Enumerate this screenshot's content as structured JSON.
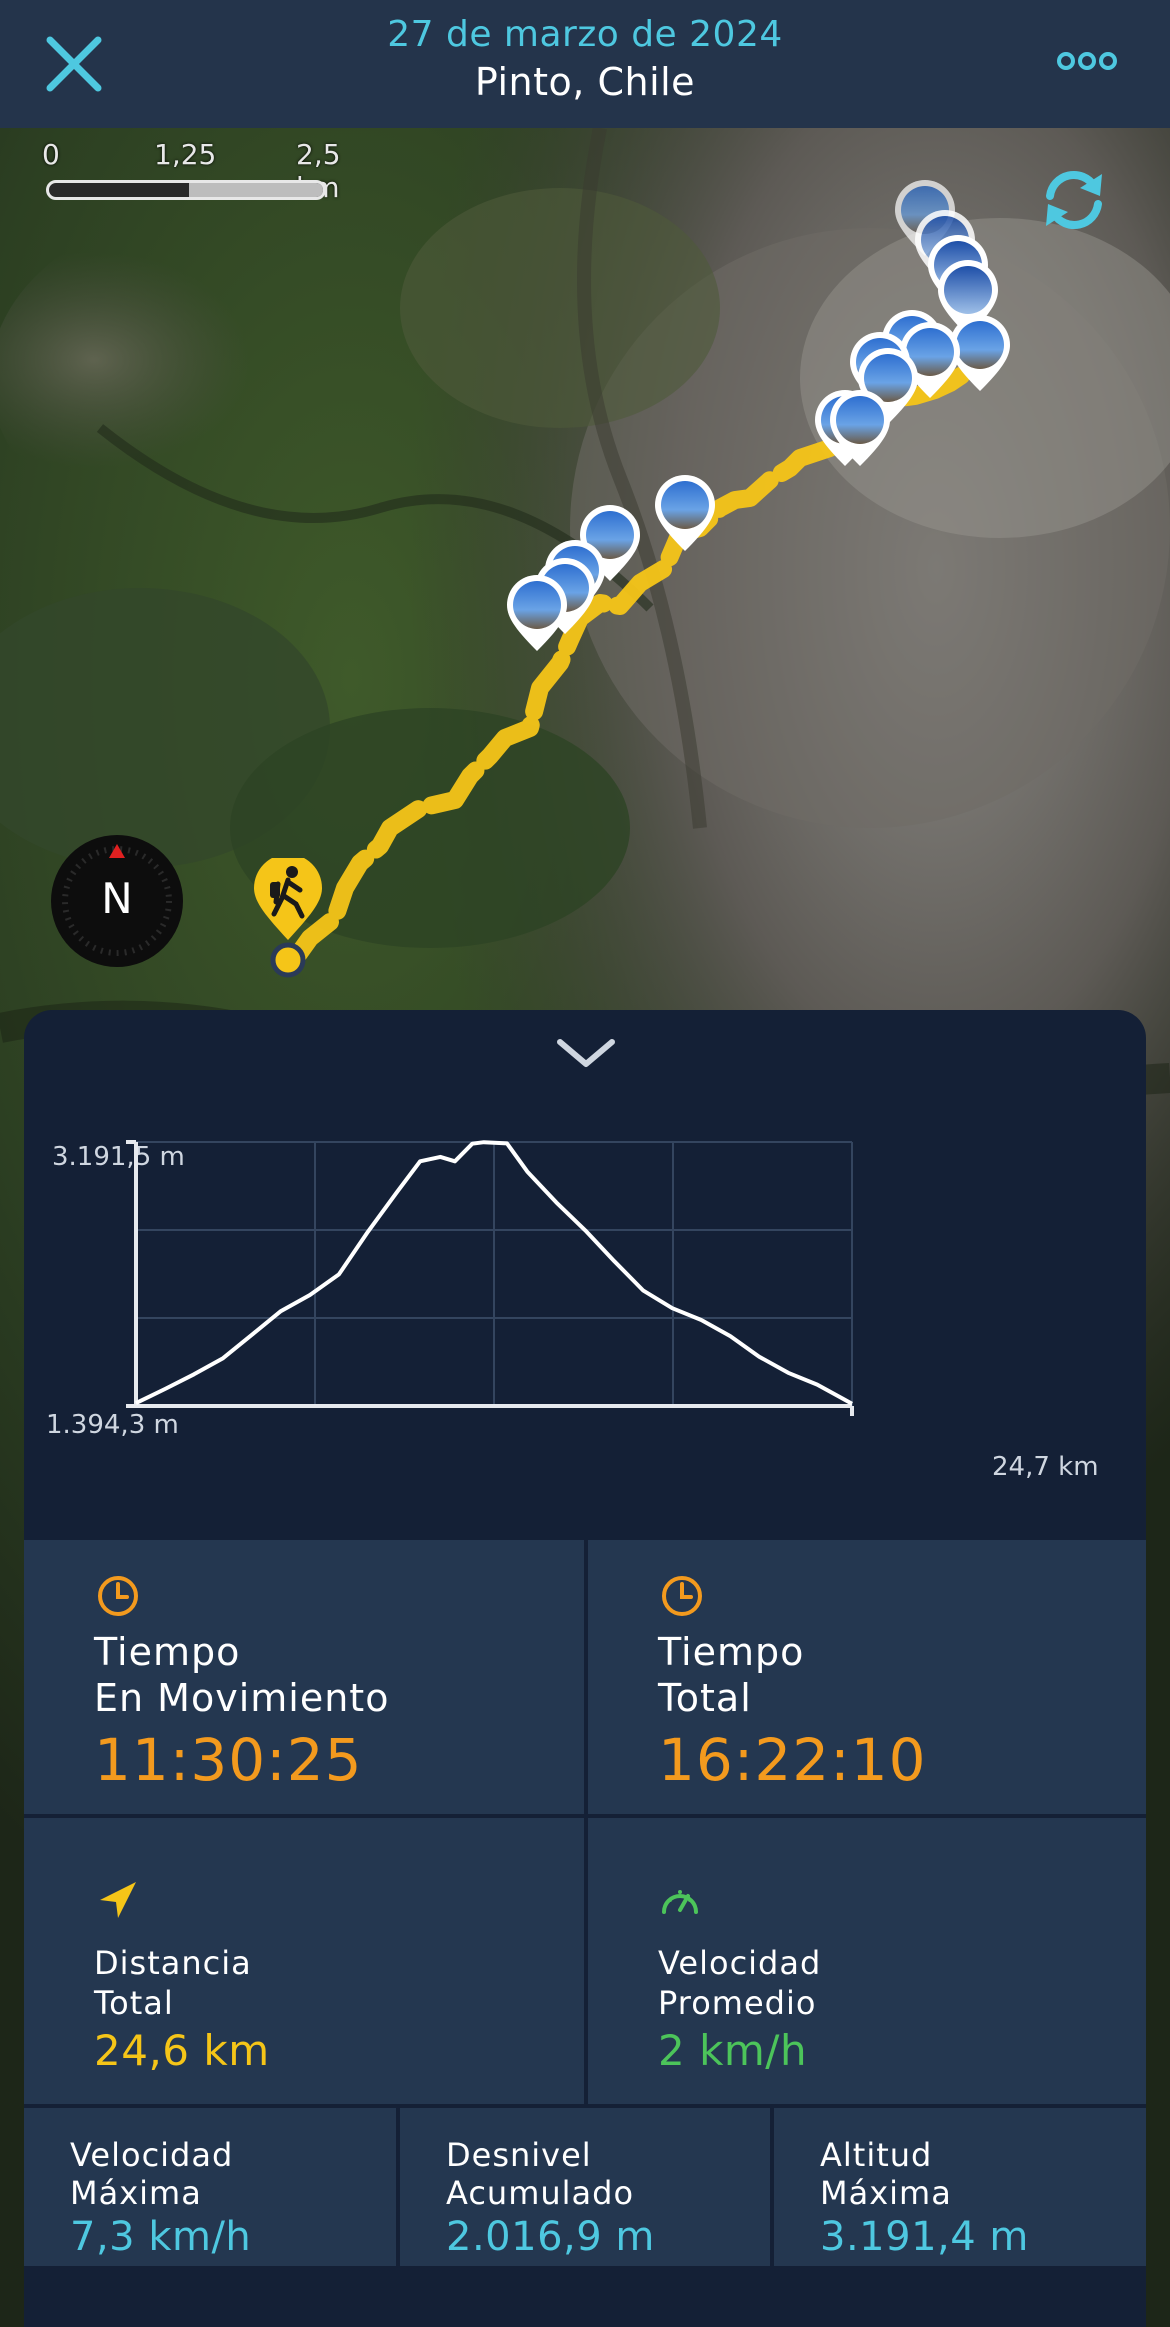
{
  "header": {
    "date": "27 de marzo de 2024",
    "location": "Pinto, Chile",
    "close_icon": "close-icon",
    "more_icon": "more-options-icon"
  },
  "map": {
    "scale_labels": [
      "0",
      "1,25",
      "2,5 km"
    ],
    "compass_label": "N",
    "route_color": "#f5c518",
    "refresh_icon": "refresh-icon",
    "start_icon": "hiker-icon"
  },
  "chart_data": {
    "type": "line",
    "title": "",
    "xlabel": "",
    "ylabel": "",
    "y_tick_labels": [
      "3.191,5 m",
      "1.394,3 m"
    ],
    "x_tick_labels": [
      "24,7 km"
    ],
    "xlim": [
      0,
      24.7
    ],
    "ylim": [
      1394.3,
      3191.5
    ],
    "grid": true,
    "series": [
      {
        "x": [
          0,
          1.0,
          2.0,
          3.0,
          4.0,
          5.0,
          6.0,
          7.0,
          8.0,
          9.0,
          9.8,
          10.5,
          11.0,
          11.6,
          12.0,
          12.8,
          13.5,
          14.5,
          15.5,
          16.5,
          17.5,
          18.5,
          19.5,
          20.5,
          21.5,
          22.5,
          23.5,
          24.7
        ],
        "y": [
          1414,
          1510,
          1610,
          1720,
          1880,
          2040,
          2150,
          2290,
          2580,
          2850,
          3060,
          3090,
          3060,
          3180,
          3190,
          3182,
          2990,
          2780,
          2590,
          2380,
          2180,
          2060,
          1980,
          1870,
          1730,
          1620,
          1540,
          1410
        ]
      }
    ]
  },
  "stats": {
    "moving_time": {
      "label_1": "Tiempo",
      "label_2": "En Movimiento",
      "value": "11:30:25",
      "icon": "clock-icon"
    },
    "total_time": {
      "label_1": "Tiempo",
      "label_2": "Total",
      "value": "16:22:10",
      "icon": "clock-icon"
    },
    "distance": {
      "label_1": "Distancia",
      "label_2": "Total",
      "value": "24,6 km",
      "icon": "navigation-arrow-icon"
    },
    "avg_speed": {
      "label_1": "Velocidad",
      "label_2": "Promedio",
      "value": "2 km/h",
      "icon": "speedometer-icon"
    },
    "max_speed": {
      "label_1": "Velocidad",
      "label_2": "Máxima",
      "value": "7,3 km/h"
    },
    "elevation_gain": {
      "label_1": "Desnivel",
      "label_2": "Acumulado",
      "value": "2.016,9 m"
    },
    "max_altitude": {
      "label_1": "Altitud",
      "label_2": "Máxima",
      "value": "3.191,4 m"
    }
  },
  "colors": {
    "accent_cyan": "#4ec8e0",
    "accent_orange": "#f39a1e",
    "accent_yellow": "#f5c518",
    "accent_green": "#4cc45a",
    "panel": "#243750"
  }
}
